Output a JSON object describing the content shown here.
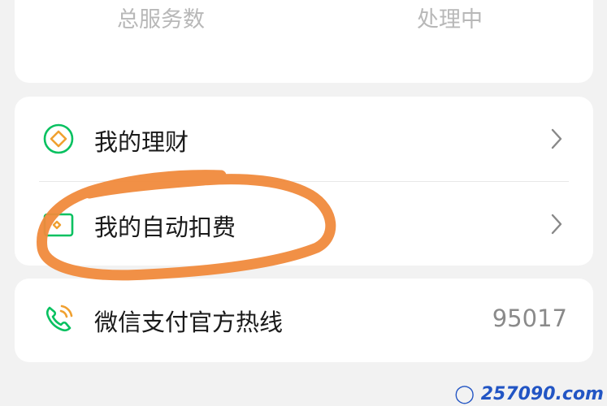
{
  "stats": {
    "left_label": "总服务数",
    "right_label": "处理中"
  },
  "menu": {
    "items": [
      {
        "label": "我的理财",
        "icon": "wealth-diamond-icon"
      },
      {
        "label": "我的自动扣费",
        "icon": "auto-deduct-card-icon"
      }
    ]
  },
  "hotline": {
    "label": "微信支付官方热线",
    "value": "95017",
    "icon": "phone-icon"
  },
  "colors": {
    "accent_green": "#07c160",
    "annotation_orange": "#f08a3c",
    "watermark_blue": "#2255c4"
  },
  "watermark": {
    "text": "257090.com"
  }
}
